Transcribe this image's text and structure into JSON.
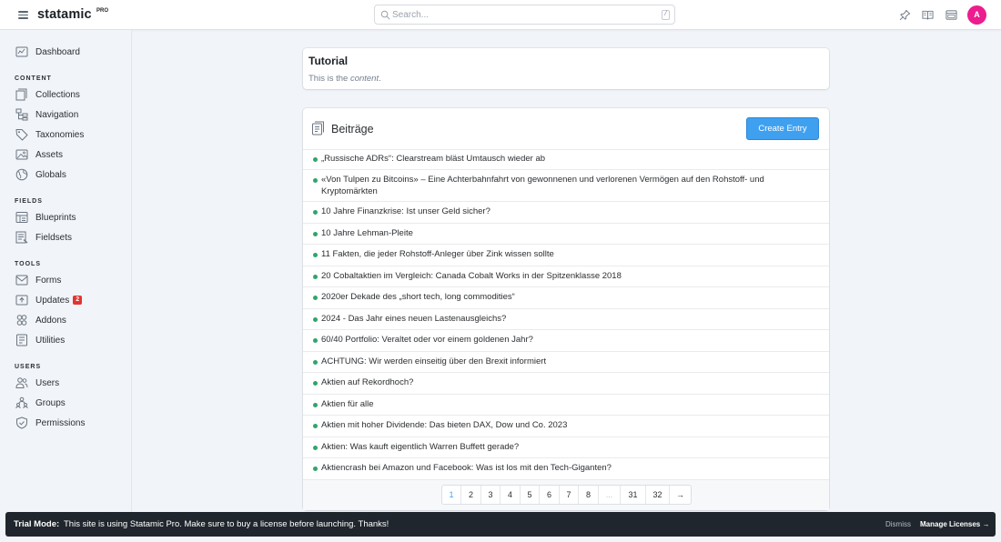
{
  "header": {
    "brand": "statamic",
    "brand_badge": "PRO",
    "search_placeholder": "Search...",
    "search_shortcut": "/",
    "avatar_initial": "A",
    "avatar_color": "#ec1d8e",
    "icons": [
      "menu-icon",
      "search-icon",
      "pin-icon",
      "book-icon",
      "site-icon"
    ]
  },
  "sidebar": {
    "dashboard": "Dashboard",
    "sections": {
      "content": "CONTENT",
      "fields": "FIELDS",
      "tools": "TOOLS",
      "users": "USERS"
    },
    "content_items": [
      "Collections",
      "Navigation",
      "Taxonomies",
      "Assets",
      "Globals"
    ],
    "fields_items": [
      "Blueprints",
      "Fieldsets"
    ],
    "tools_items": [
      "Forms",
      "Updates",
      "Addons",
      "Utilities"
    ],
    "updates_badge": "2",
    "users_items": [
      "Users",
      "Groups",
      "Permissions"
    ]
  },
  "tutorial": {
    "title": "Tutorial",
    "text_prefix": "This is the ",
    "text_em": "content",
    "text_suffix": "."
  },
  "collection": {
    "title": "Beiträge",
    "create_label": "Create Entry",
    "entries": [
      "„Russische ADRs“: Clearstream bläst Umtausch wieder ab",
      "«Von Tulpen zu Bitcoins» – Eine Achterbahnfahrt von gewonnenen und verlorenen Vermögen auf den Rohstoff- und Kryptomärkten",
      "10 Jahre Finanzkrise: Ist unser Geld sicher?",
      "10 Jahre Lehman-Pleite",
      "11 Fakten, die jeder Rohstoff-Anleger über Zink wissen sollte",
      "20 Cobaltaktien im Vergleich: Canada Cobalt Works in der Spitzenklasse 2018",
      "2020er Dekade des „short tech, long commodities“",
      "2024 - Das Jahr eines neuen Lastenausgleichs?",
      "60/40 Portfolio: Veraltet oder vor einem goldenen Jahr?",
      "ACHTUNG: Wir werden einseitig über den Brexit informiert",
      "Aktien auf Rekordhoch?",
      "Aktien für alle",
      "Aktien mit hoher Dividende: Das bieten DAX, Dow und Co. 2023",
      "Aktien: Was kauft eigentlich Warren Buffett gerade?",
      "Aktiencrash bei Amazon und Facebook: Was ist los mit den Tech-Giganten?"
    ],
    "status_color": "#2fa56b",
    "pagination": [
      "1",
      "2",
      "3",
      "4",
      "5",
      "6",
      "7",
      "8",
      "...",
      "31",
      "32",
      "→"
    ],
    "current_page": "1"
  },
  "trial": {
    "label": "Trial Mode:",
    "message": "This site is using Statamic Pro. Make sure to buy a license before launching. Thanks!",
    "dismiss": "Dismiss",
    "manage": "Manage Licenses →"
  }
}
